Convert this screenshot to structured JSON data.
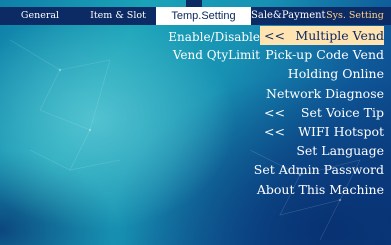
{
  "tabs": [
    {
      "label": "General"
    },
    {
      "label": "Item & Slot"
    },
    {
      "label": "Temp.Setting"
    },
    {
      "label": "Sale&Payment"
    },
    {
      "label": "Sys. Setting"
    }
  ],
  "left_menu": [
    {
      "label": "Enable/Disable"
    },
    {
      "label": "Vend QtyLimit"
    }
  ],
  "menu": [
    {
      "arrow": "<<",
      "label": "Multiple Vend"
    },
    {
      "arrow": "",
      "label": "Pick-up Code Vend"
    },
    {
      "arrow": "",
      "label": "Holding Online"
    },
    {
      "arrow": "",
      "label": "Network Diagnose"
    },
    {
      "arrow": "<<",
      "label": "Set Voice Tip"
    },
    {
      "arrow": "<<",
      "label": "WIFI Hotspot"
    },
    {
      "arrow": "",
      "label": "Set Language"
    },
    {
      "arrow": "",
      "label": "Set Admin Password"
    },
    {
      "arrow": "",
      "label": "About This Machine"
    }
  ],
  "colors": {
    "topbar": "#0c2a63",
    "selected_bg": "#ffe3b0",
    "sys_tab_text": "#ffd28a"
  }
}
